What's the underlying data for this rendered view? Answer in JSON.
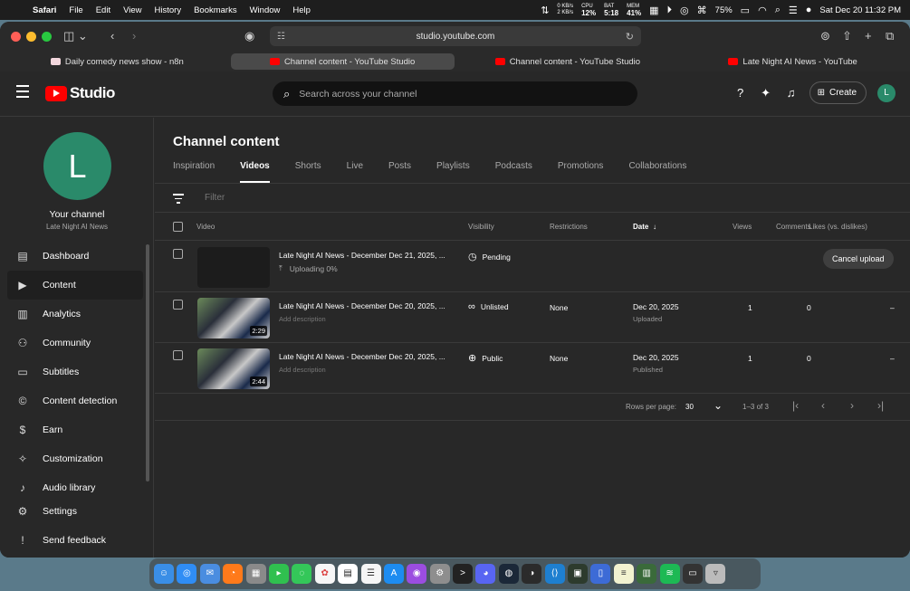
{
  "menubar": {
    "app": "Safari",
    "items": [
      "File",
      "Edit",
      "View",
      "History",
      "Bookmarks",
      "Window",
      "Help"
    ],
    "net_up": "0 KB/s",
    "net_down": "2 KB/s",
    "cpu_label": "CPU",
    "cpu_value": "12%",
    "bat_label": "BAT",
    "bat_value": "5:18",
    "mem_label": "MEM",
    "mem_value": "41%",
    "battery": "75%",
    "datetime": "Sat Dec 20  11:32 PM"
  },
  "browser": {
    "url": "studio.youtube.com",
    "tabs": [
      {
        "label": "Daily comedy news show - n8n",
        "favicon": "n8n",
        "active": false
      },
      {
        "label": "Channel content - YouTube Studio",
        "favicon": "youtube",
        "active": true
      },
      {
        "label": "Channel content - YouTube Studio",
        "favicon": "youtube",
        "active": false
      },
      {
        "label": "Late Night AI News - YouTube",
        "favicon": "youtube",
        "active": false
      }
    ]
  },
  "studio": {
    "logo_text": "Studio",
    "search_placeholder": "Search across your channel",
    "create_label": "Create",
    "avatar_letter": "L"
  },
  "sidebar": {
    "avatar_letter": "L",
    "channel_label": "Your channel",
    "channel_name": "Late Night AI News",
    "items": [
      {
        "label": "Dashboard",
        "icon": "dashboard-icon",
        "active": false
      },
      {
        "label": "Content",
        "icon": "content-icon",
        "active": true
      },
      {
        "label": "Analytics",
        "icon": "analytics-icon",
        "active": false
      },
      {
        "label": "Community",
        "icon": "community-icon",
        "active": false
      },
      {
        "label": "Subtitles",
        "icon": "subtitles-icon",
        "active": false
      },
      {
        "label": "Content detection",
        "icon": "copyright-icon",
        "active": false
      },
      {
        "label": "Earn",
        "icon": "dollar-icon",
        "active": false
      },
      {
        "label": "Customization",
        "icon": "wand-icon",
        "active": false
      },
      {
        "label": "Audio library",
        "icon": "audio-library-icon",
        "active": false
      }
    ],
    "bottom": [
      {
        "label": "Settings",
        "icon": "gear-icon"
      },
      {
        "label": "Send feedback",
        "icon": "feedback-icon"
      }
    ]
  },
  "content": {
    "title": "Channel content",
    "tabs": [
      "Inspiration",
      "Videos",
      "Shorts",
      "Live",
      "Posts",
      "Playlists",
      "Podcasts",
      "Promotions",
      "Collaborations"
    ],
    "active_tab": "Videos",
    "filter_placeholder": "Filter",
    "columns": {
      "video": "Video",
      "visibility": "Visibility",
      "restrictions": "Restrictions",
      "date": "Date",
      "views": "Views",
      "comments": "Comments",
      "likes": "Likes (vs. dislikes)"
    },
    "rows": [
      {
        "title": "Late Night AI News - December Dec 21, 2025, ...",
        "upload_status": "Uploading 0%",
        "visibility": "Pending",
        "cancel_label": "Cancel upload"
      },
      {
        "title": "Late Night AI News - December Dec 20, 2025, ...",
        "description": "Add description",
        "duration": "2:29",
        "visibility": "Unlisted",
        "restrictions": "None",
        "date": "Dec 20, 2025",
        "date_status": "Uploaded",
        "views": "1",
        "comments": "0",
        "likes": "–"
      },
      {
        "title": "Late Night AI News - December Dec 20, 2025, ...",
        "description": "Add description",
        "duration": "2:44",
        "visibility": "Public",
        "restrictions": "None",
        "date": "Dec 20, 2025",
        "date_status": "Published",
        "views": "1",
        "comments": "0",
        "likes": "–"
      }
    ],
    "pager": {
      "rows_per_page_label": "Rows per page:",
      "rows_per_page": "30",
      "range": "1–3 of 3"
    }
  },
  "colors": {
    "brand_red": "#ff0000",
    "avatar_green": "#2a8a6a",
    "background": "#282828"
  }
}
